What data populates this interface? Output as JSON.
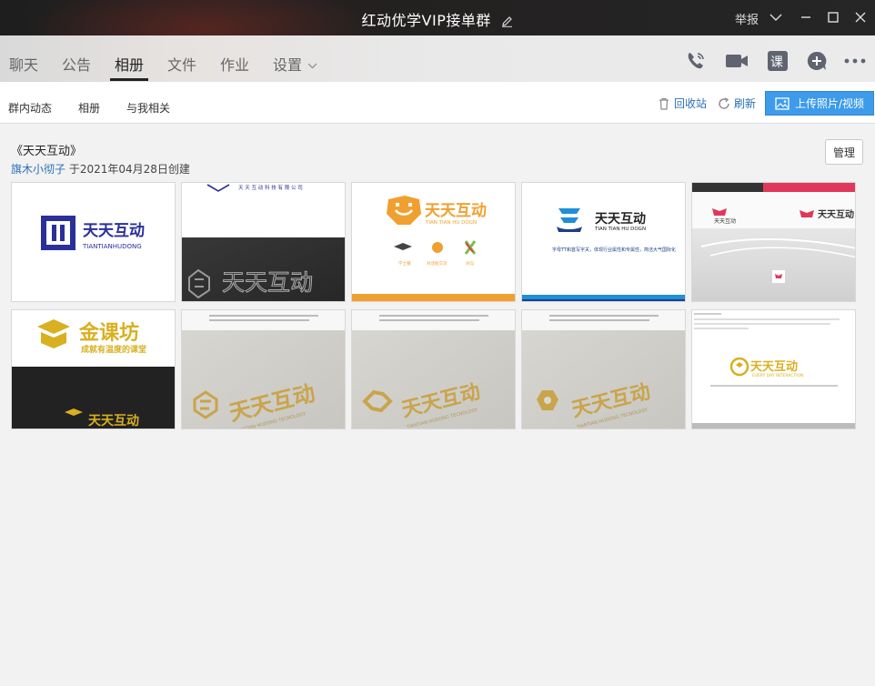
{
  "window": {
    "title": "红动优学VIP接单群",
    "report_label": "举报",
    "controls": [
      "chevron-down-icon",
      "minimize-icon",
      "maximize-icon",
      "close-icon"
    ]
  },
  "tabs": [
    {
      "label": "聊天",
      "active": false
    },
    {
      "label": "公告",
      "active": false
    },
    {
      "label": "相册",
      "active": true
    },
    {
      "label": "文件",
      "active": false
    },
    {
      "label": "作业",
      "active": false
    },
    {
      "label": "设置",
      "active": false
    }
  ],
  "right_tools": [
    "phone-icon",
    "video-icon",
    "course-icon",
    "add-app-icon",
    "more-icon"
  ],
  "course_icon_text": "课",
  "subnav": {
    "items": [
      "群内动态",
      "相册",
      "与我相关"
    ],
    "recycle_label": "回收站",
    "refresh_label": "刷新",
    "upload_label": "上传照片/视频"
  },
  "album": {
    "title": "《天天互动》",
    "author": "旗木小彻子",
    "created": "于2021年04月28日创建",
    "manage_label": "管理"
  },
  "photos": {
    "p1_logo": "天天互动",
    "p1_sub": "TIANTIANHUDONG",
    "p2_company": "天 天 互 动 科 技 有 限 公 司",
    "p2_logo": "天天互动",
    "p3_logo": "天天互动",
    "p3_sub": "TIAN TIAN HU DOGN",
    "p3_icons": [
      "学士帽",
      "对话框交流",
      "对勾"
    ],
    "p4_logo": "天天互动",
    "p4_sub": "TIAN TIAN HU DOGN",
    "p4_desc": "字母TT和首写字关，体现行业属性和专属性，简洁大气国际化",
    "p5_logo": "天天互动",
    "p6_logo": "金课坊",
    "p6_slogan": "成就有温度的课堂",
    "p6_bottom": "天天互动",
    "p7_logo": "天天互动",
    "p7_sub": "TIANTIAN HUDONG TECNOLOGY",
    "p8_logo": "天天互动",
    "p8_sub": "TIANTIAN HUDONG TECNOLOGY",
    "p9_logo": "天天互动",
    "p9_sub": "TIANTIAN HUDONG TECNOLOGY",
    "p10_logo": "天天互动",
    "p10_sub": "EVERY DAY INTERACTION"
  },
  "colors": {
    "accent_blue": "#3d9bea",
    "link_blue": "#2a6fb5",
    "navy_logo": "#2a2f9a",
    "orange": "#f0a030",
    "gold": "#d8b020",
    "gold_embossed": "#c9a44a"
  }
}
